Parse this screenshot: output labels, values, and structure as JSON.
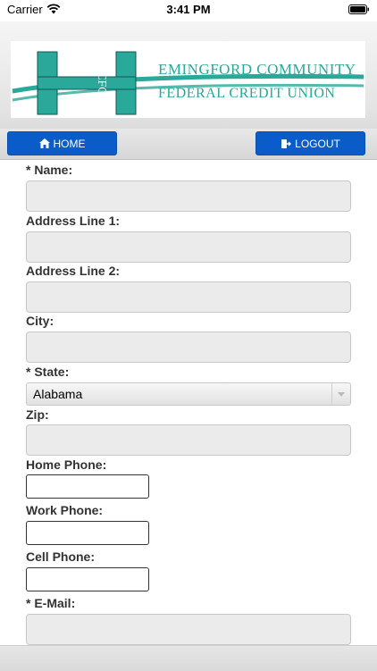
{
  "status_bar": {
    "carrier": "Carrier",
    "time": "3:41 PM"
  },
  "logo": {
    "line1": "EMINGFORD COMMUNITY",
    "line2": "FEDERAL CREDIT UNION",
    "monogram": "CFCU"
  },
  "nav": {
    "home_label": "HOME",
    "logout_label": "LOGOUT"
  },
  "form": {
    "name_label": "* Name:",
    "address1_label": "Address Line 1:",
    "address2_label": "Address Line 2:",
    "city_label": "City:",
    "state_label": "* State:",
    "state_value": "Alabama",
    "zip_label": "Zip:",
    "home_phone_label": "Home Phone:",
    "work_phone_label": "Work Phone:",
    "cell_phone_label": "Cell Phone:",
    "email_label": "* E-Mail:"
  },
  "colors": {
    "brand_teal": "#2aa89a",
    "nav_button_blue": "#0a5dc8"
  }
}
